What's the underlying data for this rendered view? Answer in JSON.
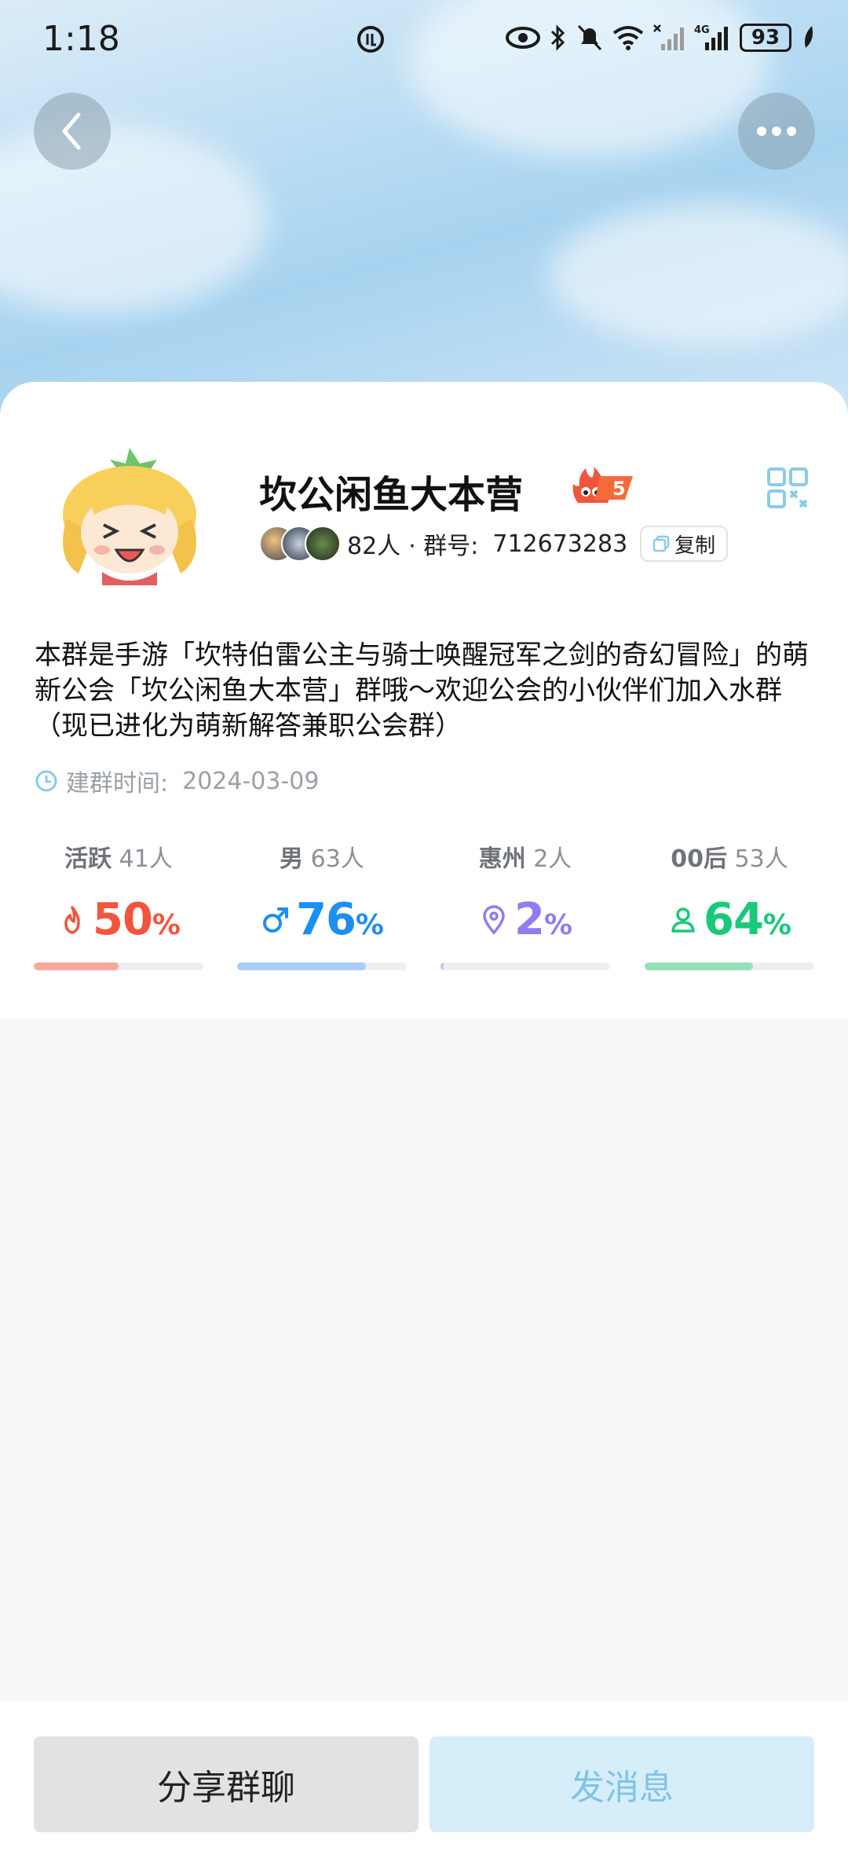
{
  "status_bar": {
    "time": "1:18",
    "battery": "93",
    "network": "4G"
  },
  "header": {
    "back_icon": "chevron-left-icon",
    "more_icon": "more-dots-icon"
  },
  "group": {
    "name": "坎公闲鱼大本营",
    "level": "5",
    "member_count": "82人",
    "group_id_label": "· 群号:",
    "group_id": "712673283",
    "copy_label": "复制",
    "description": "本群是手游「坎特伯雷公主与骑士唤醒冠军之剑的奇幻冒险」的萌新公会「坎公闲鱼大本营」群哦～欢迎公会的小伙伴们加入水群（现已进化为萌新解答兼职公会群）",
    "created_label": "建群时间:",
    "created_date": "2024-03-09"
  },
  "stats": [
    {
      "label": "活跃",
      "count": "41人",
      "value": "50",
      "unit": "%",
      "color": "#f2553d",
      "bar_color": "#f6a99b",
      "fraction": 0.5,
      "icon": "flame-icon"
    },
    {
      "label": "男",
      "count": "63人",
      "value": "76",
      "unit": "%",
      "color": "#1d8ef2",
      "bar_color": "#a9cdf5",
      "fraction": 0.76,
      "icon": "male-icon"
    },
    {
      "label": "惠州",
      "count": "2人",
      "value": "2",
      "unit": "%",
      "color": "#8f7ef0",
      "bar_color": "#c7bdf5",
      "fraction": 0.02,
      "icon": "location-pin-icon"
    },
    {
      "label": "00后",
      "count": "53人",
      "value": "64",
      "unit": "%",
      "color": "#19c97a",
      "bar_color": "#94e0b9",
      "fraction": 0.64,
      "icon": "person-icon"
    }
  ],
  "actions": {
    "share_label": "分享群聊",
    "message_label": "发消息"
  }
}
